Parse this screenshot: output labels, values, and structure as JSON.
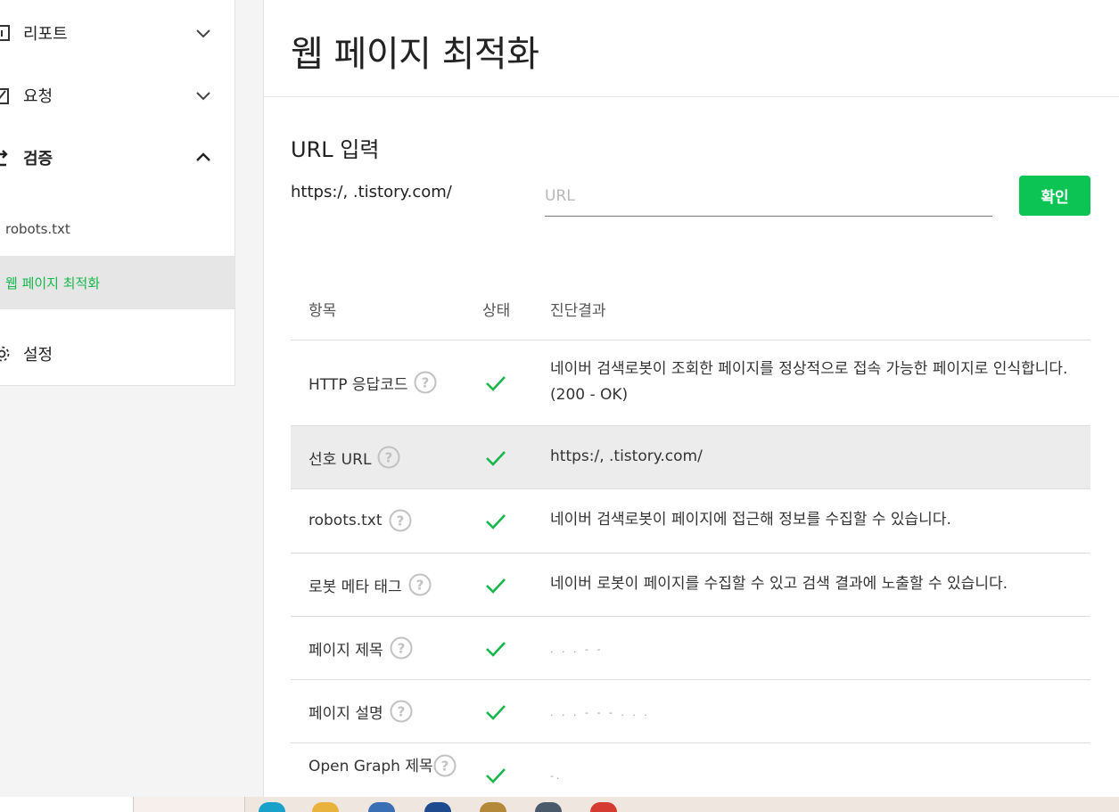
{
  "sidebar": {
    "items": [
      {
        "label": "리포트",
        "icon": "report-icon",
        "expanded": false
      },
      {
        "label": "요청",
        "icon": "request-icon",
        "expanded": false
      },
      {
        "label": "검증",
        "icon": "verify-icon",
        "expanded": true
      }
    ],
    "sub_items": [
      {
        "label": "robots.txt",
        "active": false
      },
      {
        "label": "웹 페이지 최적화",
        "active": true
      }
    ],
    "settings_label": "설정"
  },
  "main": {
    "title": "웹 페이지 최적화",
    "url_section": {
      "heading": "URL 입력",
      "prefix": "https:/,     .tistory.com/",
      "input_value": "",
      "input_placeholder": "URL",
      "confirm_label": "확인"
    },
    "table": {
      "headers": [
        "항목",
        "상태",
        "진단결과"
      ],
      "rows": [
        {
          "item": "HTTP 응답코드",
          "status": "ok",
          "result": "네이버 검색로봇이 조회한 페이지를 정상적으로 접속 가능한 페이지로 인식합니다.(200 - OK)"
        },
        {
          "item": "선호 URL",
          "status": "ok",
          "result": "https:/,            .tistory.com/",
          "highlighted": true
        },
        {
          "item": "robots.txt",
          "status": "ok",
          "result": "네이버 검색로봇이 페이지에 접근해 정보를 수집할 수 있습니다."
        },
        {
          "item": "로봇 메타 태그",
          "status": "ok",
          "result": "네이버 로봇이 페이지를 수집할 수 있고 검색 결과에 노출할 수 있습니다."
        },
        {
          "item": "페이지 제목",
          "status": "ok",
          "result": ". . . - -"
        },
        {
          "item": "페이지 설명",
          "status": "ok",
          "result": ". . . - - - . . ."
        },
        {
          "item": "Open Graph 제목",
          "status": "ok",
          "result": "-."
        }
      ]
    }
  },
  "colors": {
    "accent_green": "#0bc453",
    "check_green": "#17b74d",
    "active_bg": "#e6e6e6"
  }
}
